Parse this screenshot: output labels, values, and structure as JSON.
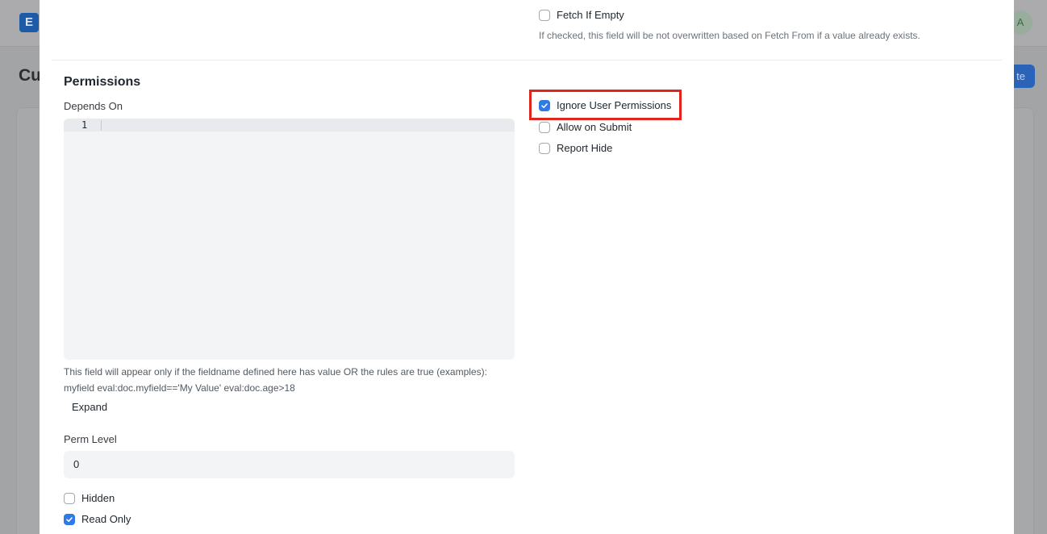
{
  "background": {
    "logo_letter": "E",
    "avatar_letter": "A",
    "page_title_partial": "Cu",
    "button_partial": "te"
  },
  "modal": {
    "fetch_if_empty": {
      "label": "Fetch If Empty",
      "checked": false,
      "help": "If checked, this field will be not overwritten based on Fetch From if a value already exists."
    },
    "permissions_section": {
      "title": "Permissions",
      "depends_on": {
        "label": "Depends On",
        "line_number": "1",
        "help_line1": "This field will appear only if the fieldname defined here has value OR the rules are true (examples):",
        "help_line2": "myfield eval:doc.myfield=='My Value' eval:doc.age>18",
        "expand_label": "Expand"
      },
      "perm_level": {
        "label": "Perm Level",
        "value": "0"
      },
      "hidden": {
        "label": "Hidden",
        "checked": false
      },
      "read_only": {
        "label": "Read Only",
        "checked": true
      },
      "ignore_user_permissions": {
        "label": "Ignore User Permissions",
        "checked": true
      },
      "allow_on_submit": {
        "label": "Allow on Submit",
        "checked": false
      },
      "report_hide": {
        "label": "Report Hide",
        "checked": false
      }
    }
  },
  "colors": {
    "checkbox_checked": "#2f7ae5",
    "highlight_border": "#e0261c"
  }
}
